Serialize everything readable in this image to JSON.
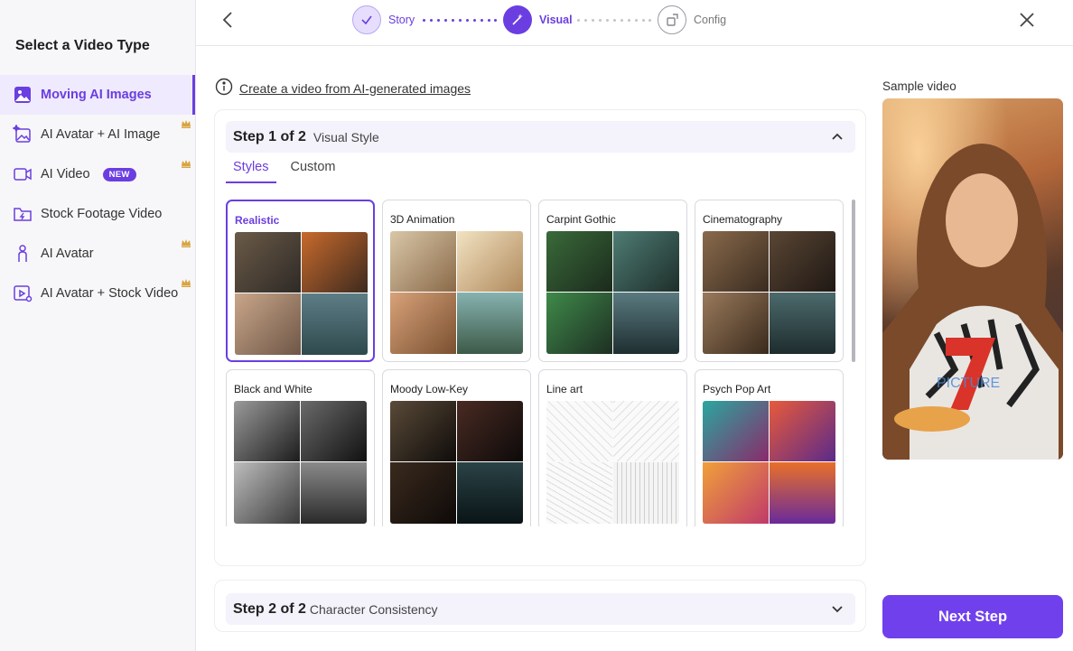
{
  "sidebar": {
    "title": "Select a Video Type",
    "items": [
      {
        "label": "Moving AI Images",
        "icon": "image-icon",
        "active": true
      },
      {
        "label": "AI Avatar + AI Image",
        "icon": "sparkle-image-icon",
        "premium": true
      },
      {
        "label": "AI Video",
        "icon": "video-camera-icon",
        "badge": "NEW",
        "premium": true
      },
      {
        "label": "Stock Footage Video",
        "icon": "folder-bolt-icon"
      },
      {
        "label": "AI Avatar",
        "icon": "person-icon",
        "premium": true
      },
      {
        "label": "AI Avatar + Stock Video",
        "icon": "play-avatar-icon",
        "premium": true
      }
    ]
  },
  "stepper": {
    "steps": [
      {
        "label": "Story",
        "state": "done"
      },
      {
        "label": "Visual",
        "state": "current"
      },
      {
        "label": "Config",
        "state": "todo"
      }
    ]
  },
  "info": {
    "text": "Create a video from AI-generated images"
  },
  "step1": {
    "number": "Step 1 of 2",
    "title": "Visual Style",
    "tabs": [
      "Styles",
      "Custom"
    ],
    "styles": [
      {
        "name": "Realistic",
        "selected": true
      },
      {
        "name": "3D Animation"
      },
      {
        "name": "Carpint Gothic"
      },
      {
        "name": "Cinematography"
      },
      {
        "name": "Black and White"
      },
      {
        "name": "Moody Low-Key"
      },
      {
        "name": "Line art"
      },
      {
        "name": "Psych Pop Art"
      }
    ]
  },
  "step2": {
    "number": "Step 2 of 2",
    "title": "Character Consistency"
  },
  "sample": {
    "label": "Sample video",
    "watermark": "PICTURE"
  },
  "actions": {
    "next": "Next Step"
  },
  "colors": {
    "accent": "#6a3ee0",
    "button": "#7040ec",
    "active_bg": "#efeafd"
  }
}
